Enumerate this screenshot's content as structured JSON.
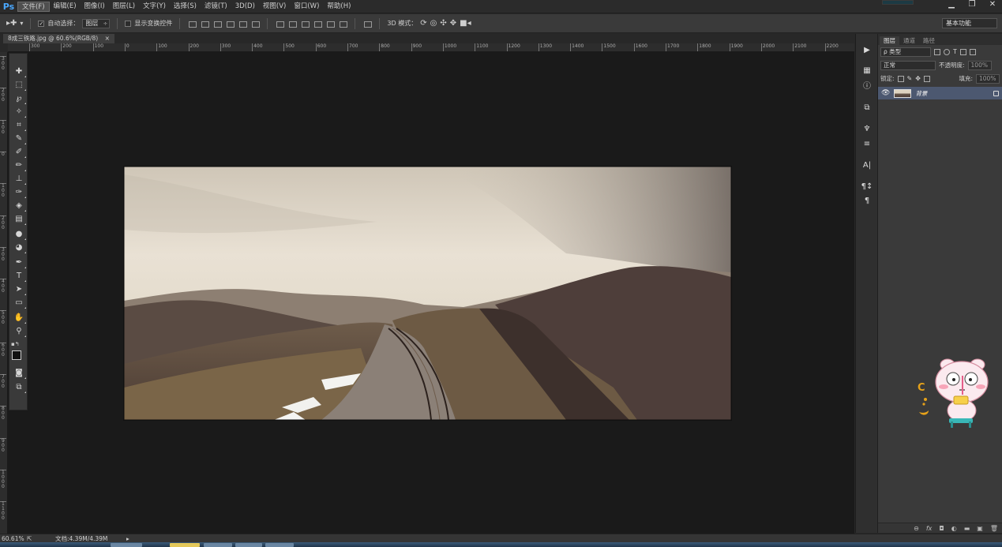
{
  "app": {
    "logo": "Ps"
  },
  "menu": [
    "文件(F)",
    "编辑(E)",
    "图像(I)",
    "图层(L)",
    "文字(Y)",
    "选择(S)",
    "滤镜(T)",
    "3D(D)",
    "视图(V)",
    "窗口(W)",
    "帮助(H)"
  ],
  "window_controls": {
    "minimize": "▁",
    "restore": "❐",
    "close": "✕"
  },
  "options_bar": {
    "auto_select_label": "自动选择：",
    "auto_select_value": "图层",
    "show_transform_label": "显示变换控件",
    "three_d_mode_label": "3D 模式：",
    "workspace": "基本功能"
  },
  "document": {
    "tab_title": "8成三铁路.jpg @ 60.6%(RGB/8)",
    "tab_close": "×",
    "zoom": "60.61%",
    "doc_size": "文档:4.39M/4.39M"
  },
  "ruler_h_labels": [
    "300",
    "200",
    "100",
    "0",
    "100",
    "200",
    "300",
    "400",
    "500",
    "600",
    "700",
    "800",
    "900",
    "1000",
    "1100",
    "1200",
    "1300",
    "1400",
    "1500",
    "1600",
    "1700",
    "1800",
    "1900",
    "2000",
    "2100",
    "2200"
  ],
  "ruler_v_labels": [
    "300",
    "200",
    "100",
    "0",
    "100",
    "200",
    "300",
    "400",
    "500",
    "600",
    "700",
    "800",
    "900",
    "1000",
    "1100"
  ],
  "layers_panel": {
    "tabs": [
      "图层",
      "通道",
      "路径"
    ],
    "filter_kind": "ρ 类型",
    "blend_mode": "正常",
    "opacity_label": "不透明度:",
    "opacity_value": "100%",
    "lock_label": "锁定:",
    "fill_label": "填充:",
    "fill_value": "100%",
    "layers": [
      {
        "name": "背景",
        "visible": true,
        "locked": true
      }
    ],
    "footer_icons": [
      "link-icon",
      "fx-icon",
      "mask-icon",
      "adjustment-icon",
      "folder-icon",
      "new-layer-icon",
      "trash-icon"
    ]
  },
  "colors": {
    "accent_blue": "#4aa8ff",
    "selected_layer": "#4c5870",
    "canvas_bg": "#1a1a1a"
  }
}
